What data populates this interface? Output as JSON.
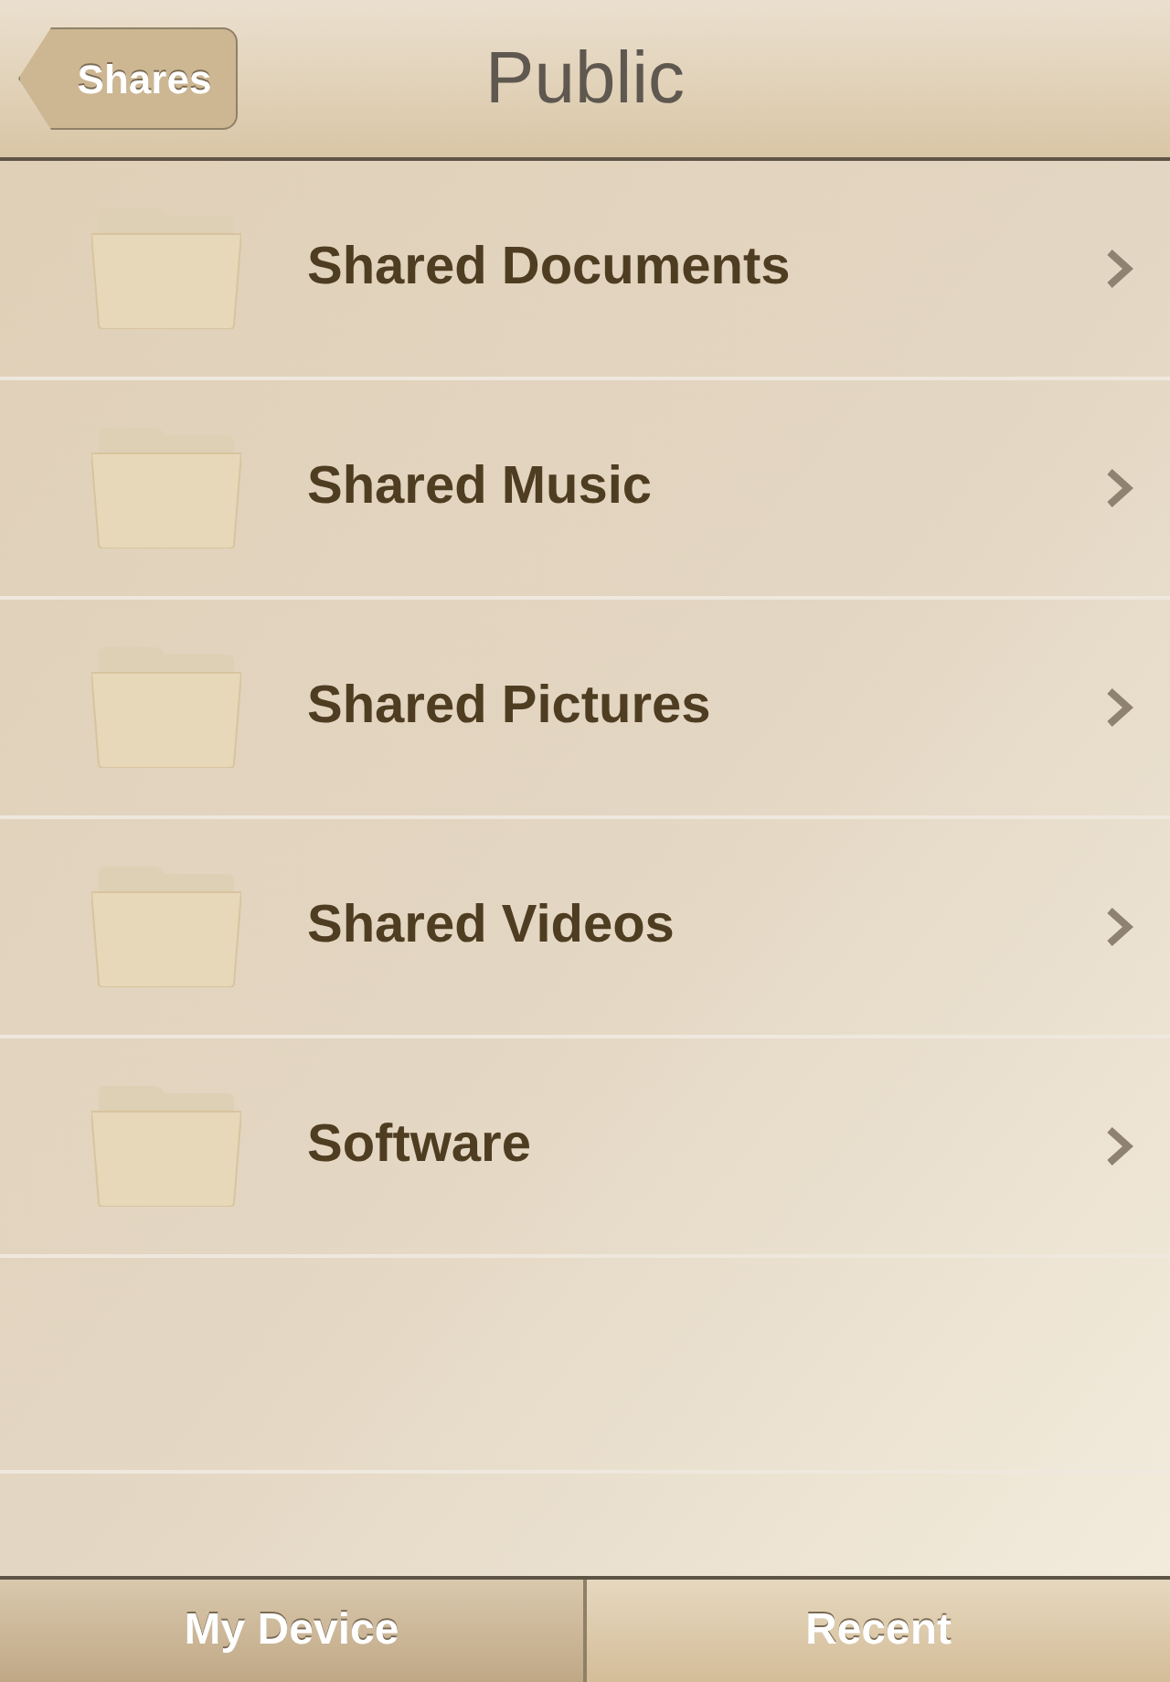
{
  "nav_bar": {
    "back_button": "Shares",
    "title": "Public"
  },
  "folders": [
    {
      "name": "Shared Documents"
    },
    {
      "name": "Shared Music"
    },
    {
      "name": "Shared Pictures"
    },
    {
      "name": "Shared Videos"
    },
    {
      "name": "Software"
    }
  ],
  "tab_bar": [
    {
      "label": "My Device",
      "selected": true
    },
    {
      "label": "Recent",
      "selected": false
    }
  ]
}
